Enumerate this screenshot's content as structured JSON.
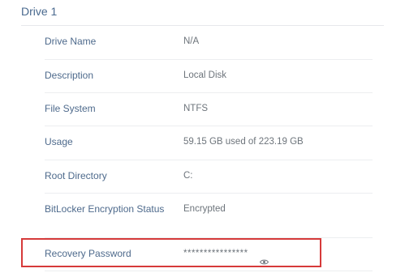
{
  "section": {
    "title": "Drive 1"
  },
  "rows": [
    {
      "label": "Drive Name",
      "value": "N/A"
    },
    {
      "label": "Description",
      "value": "Local Disk"
    },
    {
      "label": "File System",
      "value": "NTFS"
    },
    {
      "label": "Usage",
      "value": "59.15 GB used of 223.19 GB"
    },
    {
      "label": "Root Directory",
      "value": "C:"
    },
    {
      "label": "BitLocker Encryption Status",
      "value": "Encrypted"
    },
    {
      "label": "Recovery Password",
      "value": "****************"
    }
  ],
  "icons": {
    "reveal": "eye-icon"
  },
  "colors": {
    "highlight_border": "#d63a3a",
    "label": "#4e6a8c",
    "value": "#6d747b"
  }
}
